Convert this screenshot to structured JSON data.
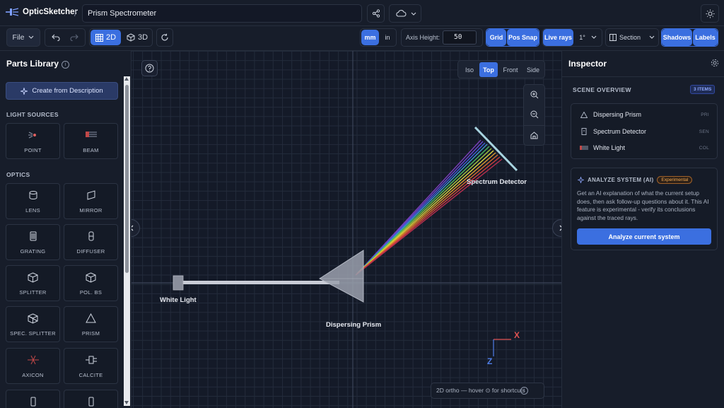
{
  "app": {
    "name": "OpticSketcher",
    "crumb_separator": "/",
    "project_name": "Prism Spectrometer"
  },
  "toolbar": {
    "file_label": "File",
    "mode_2d": "2D",
    "mode_3d": "3D",
    "unit_mm": "mm",
    "unit_in": "in",
    "axis_height_label": "Axis Height:",
    "axis_height_value": "50",
    "grid_label": "Grid",
    "pos_snap_label": "Pos Snap",
    "live_rays_label": "Live rays",
    "angle_value": "1°",
    "section_label": "Section",
    "shadows_label": "Shadows",
    "labels_label": "Labels"
  },
  "parts_library": {
    "title": "Parts Library",
    "create_button": "Create from Description",
    "sections": [
      {
        "title": "LIGHT SOURCES",
        "items": [
          {
            "label": "POINT",
            "icon": "point-source-icon"
          },
          {
            "label": "BEAM",
            "icon": "beam-icon"
          }
        ]
      },
      {
        "title": "OPTICS",
        "items": [
          {
            "label": "LENS",
            "icon": "lens-icon"
          },
          {
            "label": "MIRROR",
            "icon": "mirror-icon"
          },
          {
            "label": "GRATING",
            "icon": "grating-icon"
          },
          {
            "label": "DIFFUSER",
            "icon": "diffuser-icon"
          },
          {
            "label": "SPLITTER",
            "icon": "cube-icon"
          },
          {
            "label": "POL. BS",
            "icon": "cube-icon"
          },
          {
            "label": "SPEC. SPLITTER",
            "icon": "cube-icon"
          },
          {
            "label": "PRISM",
            "icon": "triangle-icon"
          },
          {
            "label": "AXICON",
            "icon": "axicon-icon"
          },
          {
            "label": "CALCITE",
            "icon": "calcite-icon"
          }
        ]
      }
    ]
  },
  "canvas": {
    "view_tabs": [
      "Iso",
      "Top",
      "Front",
      "Side"
    ],
    "active_view": "Top",
    "labels": {
      "white_light": "White Light",
      "prism": "Dispersing Prism",
      "detector": "Spectrum Detector"
    },
    "axes": {
      "x": "X",
      "z": "Z"
    },
    "status": "2D ortho — hover ⊙ for shortcuts",
    "colors": {
      "axis_x": "#e05252",
      "axis_z": "#4f7ee8",
      "beam": "#c9ccd6"
    }
  },
  "inspector": {
    "title": "Inspector",
    "overview_label": "SCENE OVERVIEW",
    "item_count": "3 ITEMS",
    "items": [
      {
        "name": "Dispersing Prism",
        "code": "PRI",
        "icon": "triangle-icon"
      },
      {
        "name": "Spectrum Detector",
        "code": "SEN",
        "icon": "detector-icon"
      },
      {
        "name": "White Light",
        "code": "COL",
        "icon": "beam-icon"
      }
    ],
    "ai": {
      "title": "ANALYZE SYSTEM (AI)",
      "badge": "Experimental",
      "description": "Get an AI explanation of what the current setup does, then ask follow-up questions about it. This AI feature is experimental - verify its conclusions against the traced rays.",
      "button": "Analyze current system"
    }
  },
  "accent_color": "#3b6fe0"
}
